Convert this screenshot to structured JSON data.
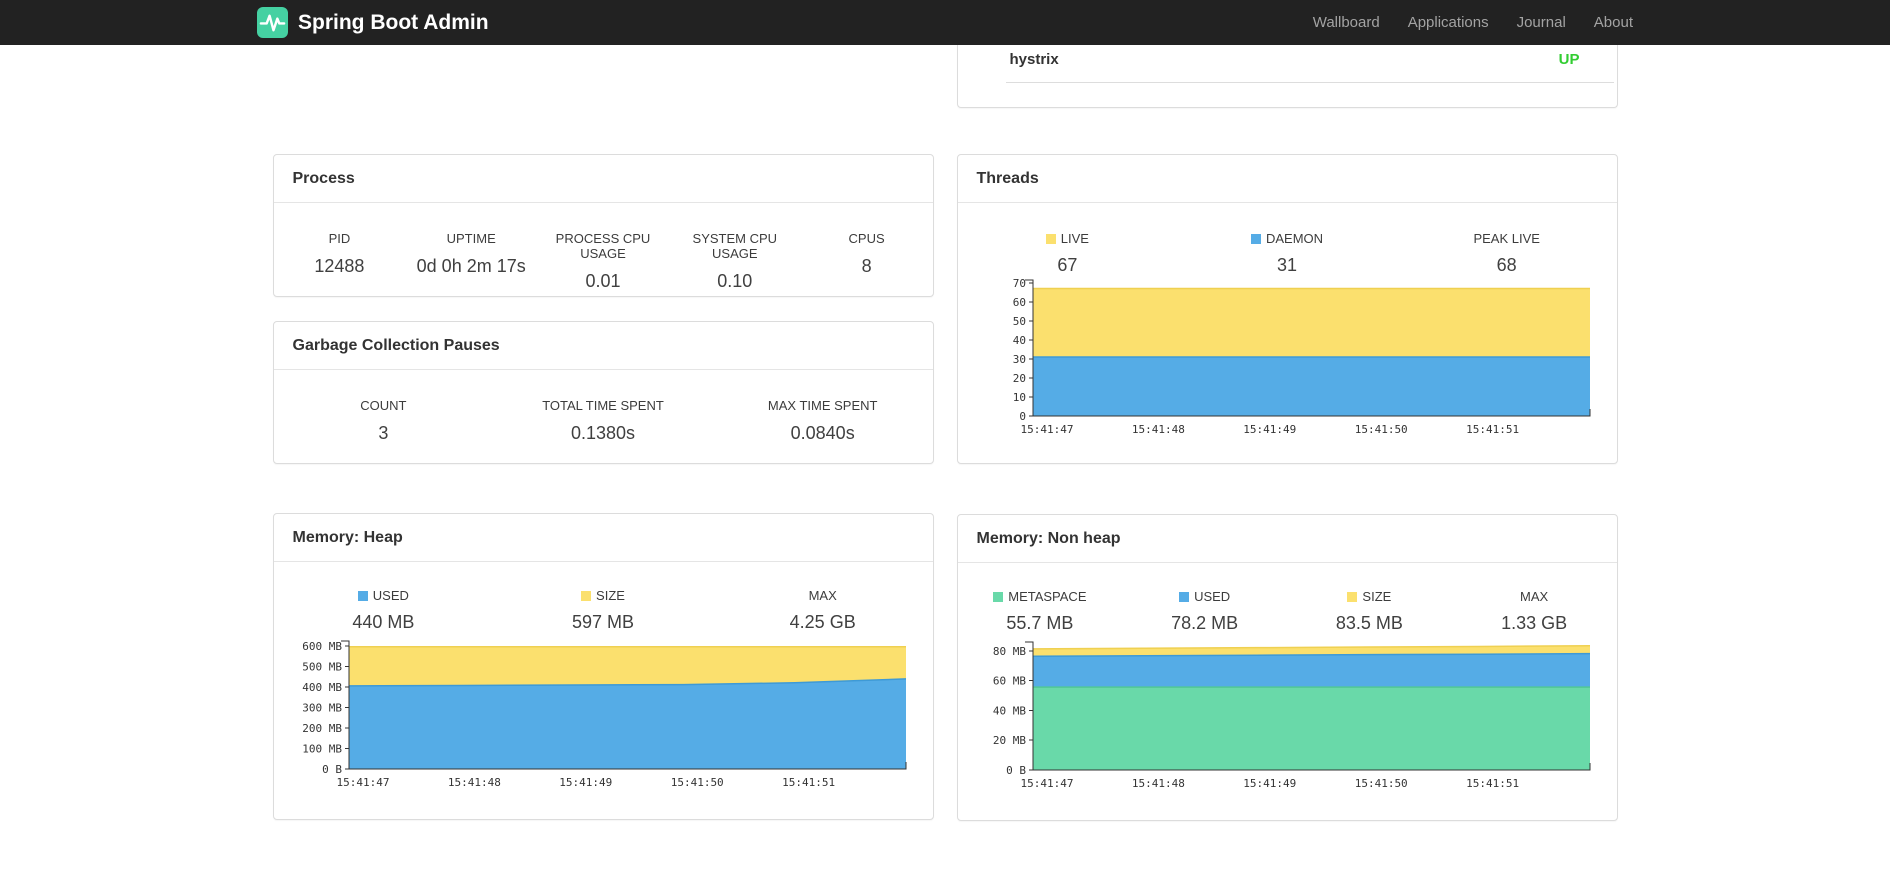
{
  "navbar": {
    "brand": "Spring Boot Admin",
    "links": [
      "Wallboard",
      "Applications",
      "Journal",
      "About"
    ]
  },
  "colors": {
    "navbar_bg": "#222222",
    "brand_green": "#45d1a2",
    "status_up": "#32cd32",
    "chart_blue": "#55ace6",
    "chart_blue_line": "#3e9ad6",
    "chart_yellow": "#fbe06e",
    "chart_yellow_line": "#efd051",
    "chart_green": "#69d9a9",
    "chart_green_line": "#52c795",
    "axis": "#333333"
  },
  "health": {
    "name": "hystrix",
    "status": "UP"
  },
  "panels": {
    "process": {
      "title": "Process",
      "metrics": [
        {
          "label": "PID",
          "value": "12488"
        },
        {
          "label": "UPTIME",
          "value": "0d 0h 2m 17s"
        },
        {
          "label": "PROCESS CPU USAGE",
          "value": "0.01"
        },
        {
          "label": "SYSTEM CPU USAGE",
          "value": "0.10"
        },
        {
          "label": "CPUS",
          "value": "8"
        }
      ]
    },
    "gc": {
      "title": "Garbage Collection Pauses",
      "metrics": [
        {
          "label": "COUNT",
          "value": "3"
        },
        {
          "label": "TOTAL TIME SPENT",
          "value": "0.1380s"
        },
        {
          "label": "MAX TIME SPENT",
          "value": "0.0840s"
        }
      ]
    },
    "threads": {
      "title": "Threads",
      "legend": [
        {
          "label": "LIVE",
          "value": "67",
          "color": "chart_yellow"
        },
        {
          "label": "DAEMON",
          "value": "31",
          "color": "chart_blue"
        },
        {
          "label": "PEAK LIVE",
          "value": "68"
        }
      ]
    },
    "heap": {
      "title": "Memory: Heap",
      "legend": [
        {
          "label": "USED",
          "value": "440 MB",
          "color": "chart_blue"
        },
        {
          "label": "SIZE",
          "value": "597 MB",
          "color": "chart_yellow"
        },
        {
          "label": "MAX",
          "value": "4.25 GB"
        }
      ]
    },
    "nonheap": {
      "title": "Memory: Non heap",
      "legend": [
        {
          "label": "METASPACE",
          "value": "55.7 MB",
          "color": "chart_green"
        },
        {
          "label": "USED",
          "value": "78.2 MB",
          "color": "chart_blue"
        },
        {
          "label": "SIZE",
          "value": "83.5 MB",
          "color": "chart_yellow"
        },
        {
          "label": "MAX",
          "value": "1.33 GB"
        }
      ]
    }
  },
  "chart_data": [
    {
      "id": "threads",
      "type": "area",
      "title": "Threads",
      "x_labels": [
        "15:41:47",
        "15:41:48",
        "15:41:49",
        "15:41:50",
        "15:41:51"
      ],
      "ylim": [
        0,
        71.5
      ],
      "yticks": [
        {
          "v": 0,
          "label": "0"
        },
        {
          "v": 10,
          "label": "10"
        },
        {
          "v": 20,
          "label": "20"
        },
        {
          "v": 30,
          "label": "30"
        },
        {
          "v": 40,
          "label": "40"
        },
        {
          "v": 50,
          "label": "50"
        },
        {
          "v": 60,
          "label": "60"
        },
        {
          "v": 70,
          "label": "70"
        }
      ],
      "series": [
        {
          "name": "LIVE",
          "color": "chart_yellow",
          "line": "chart_yellow_line",
          "values": [
            67,
            67,
            67,
            67,
            67,
            67
          ]
        },
        {
          "name": "DAEMON",
          "color": "chart_blue",
          "line": "chart_blue_line",
          "values": [
            31,
            31,
            31,
            31,
            31,
            31
          ]
        }
      ],
      "legend_position": "top"
    },
    {
      "id": "heap",
      "type": "area",
      "title": "Memory: Heap",
      "unit": "MB",
      "x_labels": [
        "15:41:47",
        "15:41:48",
        "15:41:49",
        "15:41:50",
        "15:41:51"
      ],
      "ylim": [
        0,
        625
      ],
      "yticks": [
        {
          "v": 0,
          "label": "0 B"
        },
        {
          "v": 100,
          "label": "100 MB"
        },
        {
          "v": 200,
          "label": "200 MB"
        },
        {
          "v": 300,
          "label": "300 MB"
        },
        {
          "v": 400,
          "label": "400 MB"
        },
        {
          "v": 500,
          "label": "500 MB"
        },
        {
          "v": 600,
          "label": "600 MB"
        }
      ],
      "series": [
        {
          "name": "SIZE",
          "color": "chart_yellow",
          "line": "chart_yellow_line",
          "values": [
            597,
            597,
            597,
            597,
            597,
            597
          ]
        },
        {
          "name": "USED",
          "color": "chart_blue",
          "line": "chart_blue_line",
          "values": [
            406,
            408,
            410,
            412,
            421,
            440
          ]
        }
      ],
      "legend_position": "top"
    },
    {
      "id": "nonheap",
      "type": "area",
      "title": "Memory: Non heap",
      "unit": "MB",
      "x_labels": [
        "15:41:47",
        "15:41:48",
        "15:41:49",
        "15:41:50",
        "15:41:51"
      ],
      "ylim": [
        0,
        86
      ],
      "yticks": [
        {
          "v": 0,
          "label": "0 B"
        },
        {
          "v": 20,
          "label": "20 MB"
        },
        {
          "v": 40,
          "label": "40 MB"
        },
        {
          "v": 60,
          "label": "60 MB"
        },
        {
          "v": 80,
          "label": "80 MB"
        }
      ],
      "series": [
        {
          "name": "SIZE",
          "color": "chart_yellow",
          "line": "chart_yellow_line",
          "values": [
            81.4,
            81.8,
            82.2,
            82.6,
            83.0,
            83.5
          ]
        },
        {
          "name": "USED",
          "color": "chart_blue",
          "line": "chart_blue_line",
          "values": [
            76.4,
            76.8,
            77.1,
            77.5,
            77.8,
            78.2
          ]
        },
        {
          "name": "METASPACE",
          "color": "chart_green",
          "line": "chart_green_line",
          "values": [
            55.7,
            55.7,
            55.7,
            55.7,
            55.7,
            55.7
          ]
        }
      ],
      "legend_position": "top"
    }
  ]
}
